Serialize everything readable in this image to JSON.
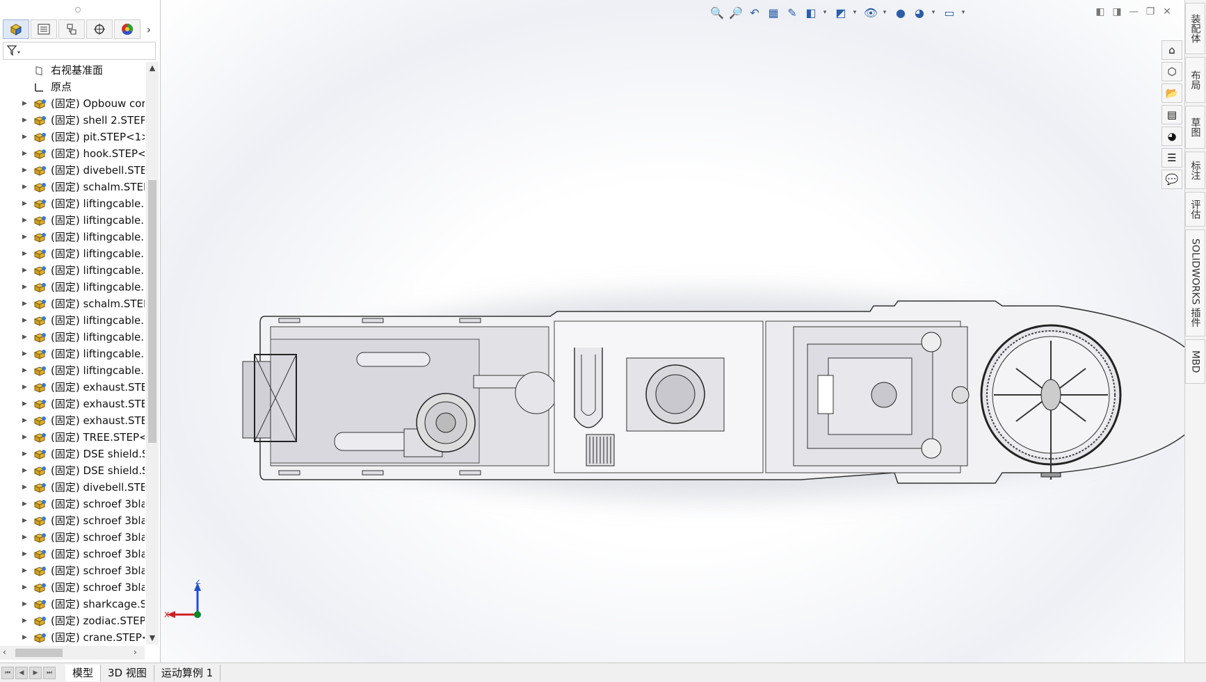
{
  "tree": {
    "items": [
      {
        "label": "右视基准面",
        "kind": "plane",
        "expandable": false
      },
      {
        "label": "原点",
        "kind": "origin",
        "expandable": false
      },
      {
        "label": "(固定) Opbouw cor",
        "kind": "part",
        "expandable": true
      },
      {
        "label": "(固定) shell 2.STEP<",
        "kind": "part",
        "expandable": true
      },
      {
        "label": "(固定) pit.STEP<1>",
        "kind": "part",
        "expandable": true
      },
      {
        "label": "(固定) hook.STEP<1",
        "kind": "part",
        "expandable": true
      },
      {
        "label": "(固定) divebell.STEI",
        "kind": "part",
        "expandable": true
      },
      {
        "label": "(固定) schalm.STEP",
        "kind": "part",
        "expandable": true
      },
      {
        "label": "(固定) liftingcable.S",
        "kind": "part",
        "expandable": true
      },
      {
        "label": "(固定) liftingcable.S",
        "kind": "part",
        "expandable": true
      },
      {
        "label": "(固定) liftingcable.S",
        "kind": "part",
        "expandable": true
      },
      {
        "label": "(固定) liftingcable.S",
        "kind": "part",
        "expandable": true
      },
      {
        "label": "(固定) liftingcable.S",
        "kind": "part",
        "expandable": true
      },
      {
        "label": "(固定) liftingcable.S",
        "kind": "part",
        "expandable": true
      },
      {
        "label": "(固定) schalm.STEP",
        "kind": "part",
        "expandable": true
      },
      {
        "label": "(固定) liftingcable.S",
        "kind": "part",
        "expandable": true
      },
      {
        "label": "(固定) liftingcable.S",
        "kind": "part",
        "expandable": true
      },
      {
        "label": "(固定) liftingcable.S",
        "kind": "part",
        "expandable": true
      },
      {
        "label": "(固定) liftingcable.S",
        "kind": "part",
        "expandable": true
      },
      {
        "label": "(固定) exhaust.STEF",
        "kind": "part",
        "expandable": true
      },
      {
        "label": "(固定) exhaust.STEF",
        "kind": "part",
        "expandable": true
      },
      {
        "label": "(固定) exhaust.STEF",
        "kind": "part",
        "expandable": true
      },
      {
        "label": "(固定) TREE.STEP<1",
        "kind": "part",
        "expandable": true
      },
      {
        "label": "(固定) DSE shield.S",
        "kind": "part",
        "expandable": true
      },
      {
        "label": "(固定) DSE shield.S",
        "kind": "part",
        "expandable": true
      },
      {
        "label": "(固定) divebell.STEI",
        "kind": "part",
        "expandable": true
      },
      {
        "label": "(固定) schroef 3bla",
        "kind": "part",
        "expandable": true
      },
      {
        "label": "(固定) schroef 3bla",
        "kind": "part",
        "expandable": true
      },
      {
        "label": "(固定) schroef 3bla",
        "kind": "part",
        "expandable": true
      },
      {
        "label": "(固定) schroef 3bla",
        "kind": "part",
        "expandable": true
      },
      {
        "label": "(固定) schroef 3bla",
        "kind": "part",
        "expandable": true
      },
      {
        "label": "(固定) schroef 3bla",
        "kind": "part",
        "expandable": true
      },
      {
        "label": "(固定) sharkcage.ST",
        "kind": "part",
        "expandable": true
      },
      {
        "label": "(固定) zodiac.STEP<",
        "kind": "part",
        "expandable": true
      },
      {
        "label": "(固定) crane.STEP<",
        "kind": "part",
        "expandable": true
      }
    ]
  },
  "right_tabs": [
    "装配体",
    "布局",
    "草图",
    "标注",
    "评估",
    "SOLIDWORKS 插件",
    "MBD"
  ],
  "bottom_tabs": [
    "模型",
    "3D 视图",
    "运动算例 1"
  ],
  "triad": {
    "z": "Z",
    "x": "X"
  },
  "colors": {
    "accent": "#2a5ea8",
    "part_icon": "#e0b030",
    "axis_z": "#2050d0",
    "axis_x": "#d02020",
    "origin": "#0a8a2a"
  }
}
